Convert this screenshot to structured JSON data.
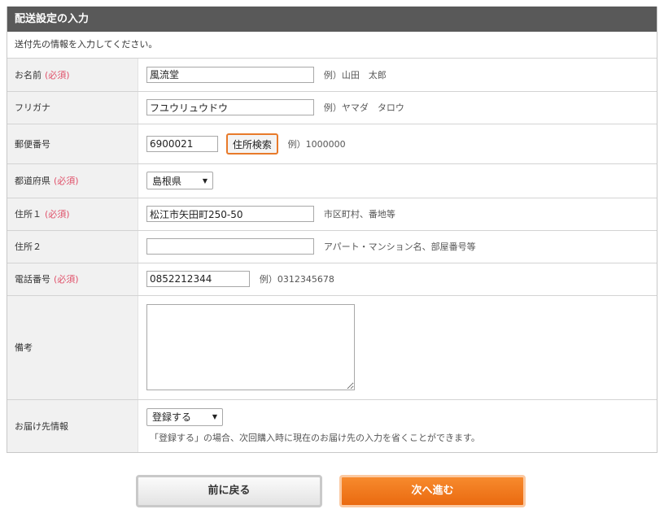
{
  "header": {
    "title": "配送設定の入力"
  },
  "intro": "送付先の情報を入力してください。",
  "required_mark": "(必須)",
  "fields": {
    "name": {
      "label": "お名前",
      "value": "風流堂",
      "example": "例）山田　太郎"
    },
    "furigana": {
      "label": "フリガナ",
      "value": "フユウリュウドウ",
      "example": "例）ヤマダ　タロウ"
    },
    "postal": {
      "label": "郵便番号",
      "value": "6900021",
      "search_button": "住所検索",
      "example": "例）1000000"
    },
    "prefecture": {
      "label": "都道府県",
      "selected": "島根県"
    },
    "address1": {
      "label": "住所１",
      "value": "松江市矢田町250-50",
      "example": "市区町村、番地等"
    },
    "address2": {
      "label": "住所２",
      "value": "",
      "example": "アパート・マンション名、部屋番号等"
    },
    "phone": {
      "label": "電話番号",
      "value": "0852212344",
      "example": "例）0312345678"
    },
    "remarks": {
      "label": "備考",
      "value": ""
    },
    "delivery_info": {
      "label": "お届け先情報",
      "selected": "登録する",
      "note": "「登録する」の場合、次回購入時に現在のお届け先の入力を省くことができます。"
    }
  },
  "buttons": {
    "back": "前に戻る",
    "next": "次へ進む"
  },
  "colors": {
    "header_bg": "#595959",
    "required": "#e0516a",
    "accent": "#ea6a10"
  }
}
